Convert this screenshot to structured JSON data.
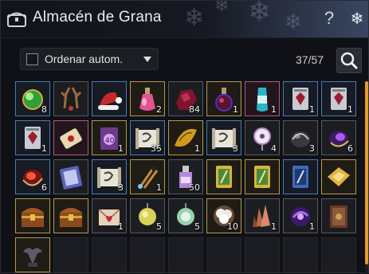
{
  "window": {
    "title": "Almacén de Grana",
    "help_label": "?",
    "close_icon": "snowflake-close-icon"
  },
  "toolbar": {
    "sort_label": "Ordenar autom.",
    "sort_checked": false,
    "count": "37/57",
    "search_icon": "search-icon"
  },
  "colors": {
    "accent_scrollbar": "#e59c2b",
    "gold_border": "#b59a4a",
    "blue_border": "#4b7ab3",
    "pink_border": "#b3577a"
  },
  "slots": [
    {
      "icon": "green-orb-icon",
      "qty": "8"
    },
    {
      "icon": "reindeer-antlers-icon",
      "qty": ""
    },
    {
      "icon": "santa-hat-icon",
      "qty": ""
    },
    {
      "icon": "pink-potion-icon",
      "qty": "2"
    },
    {
      "icon": "red-ore-icon",
      "qty": "84"
    },
    {
      "icon": "dark-red-flask-icon",
      "qty": "1"
    },
    {
      "icon": "cyan-elixir-icon",
      "qty": "1"
    },
    {
      "icon": "fortress-crest-icon",
      "qty": "1"
    },
    {
      "icon": "fortress-crest-icon",
      "qty": "1"
    },
    {
      "icon": "fortress-crest-icon",
      "qty": "1"
    },
    {
      "icon": "sealed-scroll-icon",
      "qty": ""
    },
    {
      "icon": "purple-book-40-icon",
      "qty": "1"
    },
    {
      "icon": "crafting-scroll-icon",
      "qty": "35"
    },
    {
      "icon": "gold-parchment-icon",
      "qty": "1"
    },
    {
      "icon": "crafting-scroll-icon",
      "qty": "3"
    },
    {
      "icon": "dreamcatcher-icon",
      "qty": "4"
    },
    {
      "icon": "dark-stone-icon",
      "qty": "3"
    },
    {
      "icon": "violet-gem-icon",
      "qty": "6"
    },
    {
      "icon": "red-gem-icon",
      "qty": "6"
    },
    {
      "icon": "purple-tome-icon",
      "qty": ""
    },
    {
      "icon": "crafting-scroll-icon",
      "qty": "3"
    },
    {
      "icon": "bronze-tongs-icon",
      "qty": "1"
    },
    {
      "icon": "purple-bottle-icon",
      "qty": "50"
    },
    {
      "icon": "green-card-icon",
      "qty": ""
    },
    {
      "icon": "green-card-icon",
      "qty": ""
    },
    {
      "icon": "blue-card-icon",
      "qty": ""
    },
    {
      "icon": "gold-map-icon",
      "qty": ""
    },
    {
      "icon": "treasure-chest-icon",
      "qty": ""
    },
    {
      "icon": "treasure-chest-icon",
      "qty": ""
    },
    {
      "icon": "heart-letter-icon",
      "qty": "1"
    },
    {
      "icon": "yellow-lantern-icon",
      "qty": "5"
    },
    {
      "icon": "green-lantern-icon",
      "qty": "5"
    },
    {
      "icon": "cotton-fluff-icon",
      "qty": "10"
    },
    {
      "icon": "copper-crystal-icon",
      "qty": "1"
    },
    {
      "icon": "purple-orb-icon",
      "qty": "1"
    },
    {
      "icon": "brown-tome-icon",
      "qty": ""
    },
    {
      "icon": "dragon-statue-icon",
      "qty": ""
    },
    {
      "icon": "",
      "qty": ""
    },
    {
      "icon": "",
      "qty": ""
    },
    {
      "icon": "",
      "qty": ""
    },
    {
      "icon": "",
      "qty": ""
    },
    {
      "icon": "",
      "qty": ""
    },
    {
      "icon": "",
      "qty": ""
    },
    {
      "icon": "",
      "qty": ""
    },
    {
      "icon": "",
      "qty": ""
    }
  ]
}
